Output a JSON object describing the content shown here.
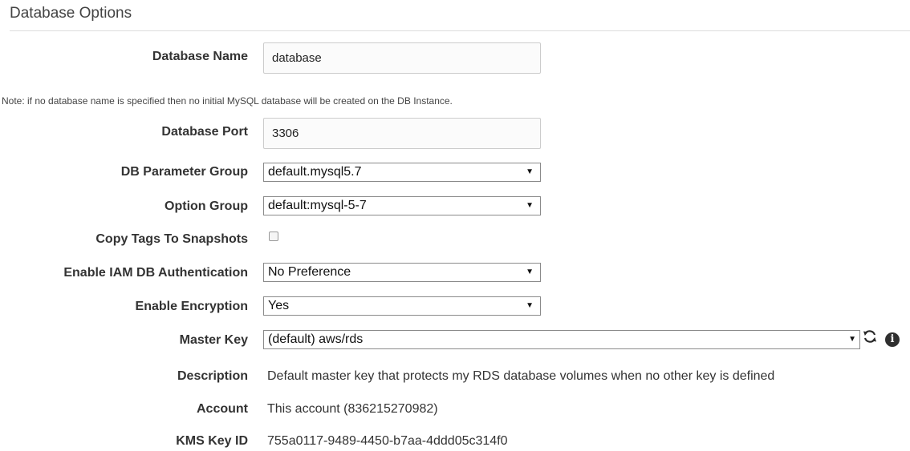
{
  "section": {
    "title": "Database Options"
  },
  "fields": {
    "database_name": {
      "label": "Database Name",
      "value": "database"
    },
    "note": "Note: if no database name is specified then no initial MySQL database will be created on the DB Instance.",
    "database_port": {
      "label": "Database Port",
      "value": "3306"
    },
    "db_parameter_group": {
      "label": "DB Parameter Group",
      "value": "default.mysql5.7"
    },
    "option_group": {
      "label": "Option Group",
      "value": "default:mysql-5-7"
    },
    "copy_tags": {
      "label": "Copy Tags To Snapshots",
      "checked": false
    },
    "iam_auth": {
      "label": "Enable IAM DB Authentication",
      "value": "No Preference"
    },
    "encryption": {
      "label": "Enable Encryption",
      "value": "Yes"
    },
    "master_key": {
      "label": "Master Key",
      "value": "(default) aws/rds"
    },
    "description": {
      "label": "Description",
      "value": "Default master key that protects my RDS database volumes when no other key is defined"
    },
    "account": {
      "label": "Account",
      "value": "This account (836215270982)"
    },
    "kms_key_id": {
      "label": "KMS Key ID",
      "value": "755a0117-9489-4450-b7aa-4ddd05c314f0"
    }
  },
  "icons": {
    "dropdown_arrow": "▼",
    "refresh": "refresh-icon",
    "info": "i"
  }
}
